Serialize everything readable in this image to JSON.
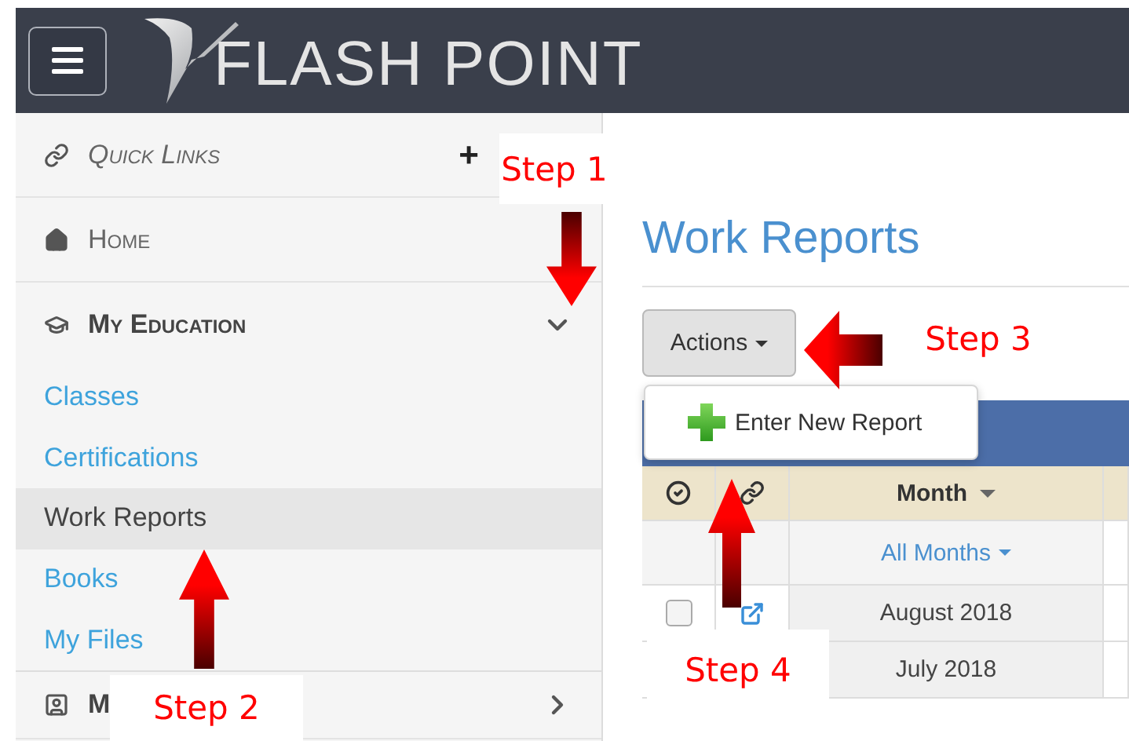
{
  "header": {
    "brand": "FLASH POINT"
  },
  "sidebar": {
    "items": [
      {
        "kind": "quick",
        "label": "Quick Links",
        "action": "+"
      },
      {
        "kind": "nav",
        "label": "Home"
      },
      {
        "kind": "section",
        "label": "My Education",
        "expanded": true,
        "children": [
          {
            "label": "Classes",
            "selected": false
          },
          {
            "label": "Certifications",
            "selected": false
          },
          {
            "label": "Work Reports",
            "selected": true
          },
          {
            "label": "Books",
            "selected": false
          },
          {
            "label": "My Files",
            "selected": false
          }
        ]
      },
      {
        "kind": "section",
        "label": "M",
        "expanded": false
      }
    ]
  },
  "main": {
    "title": "Work Reports",
    "actions_button": "Actions",
    "menu": [
      {
        "label": "Enter New Report"
      }
    ],
    "table": {
      "columns": [
        {
          "kind": "check"
        },
        {
          "kind": "link"
        },
        {
          "kind": "sort",
          "label": "Month"
        },
        {
          "kind": "blank"
        }
      ],
      "filter": "All Months",
      "rows": [
        {
          "month": "August 2018",
          "checked": false
        },
        {
          "month": "July 2018"
        }
      ]
    }
  },
  "annotations": [
    {
      "label": "Step 1"
    },
    {
      "label": "Step 2"
    },
    {
      "label": "Step 3"
    },
    {
      "label": "Step 4"
    }
  ]
}
